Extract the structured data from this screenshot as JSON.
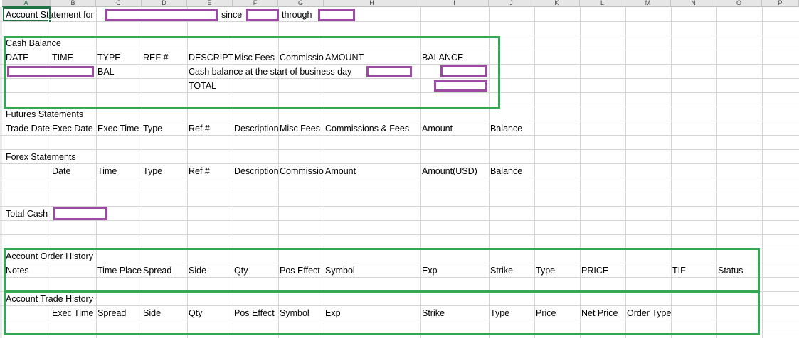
{
  "columns": [
    "A",
    "B",
    "C",
    "D",
    "E",
    "F",
    "G",
    "H",
    "I",
    "J",
    "K",
    "L",
    "M",
    "N",
    "O",
    "P"
  ],
  "header": {
    "account_statement_for": "Account Statement for",
    "since": "since",
    "through": "through"
  },
  "cash_balance": {
    "title": "Cash Balance",
    "headers": [
      "DATE",
      "TIME",
      "TYPE",
      "REF #",
      "DESCRIPTION",
      "Misc Fees",
      "Commissions",
      "AMOUNT",
      "BALANCE"
    ],
    "row_type": "BAL",
    "row_description": "Cash balance at the start of business day",
    "total_label": "TOTAL"
  },
  "futures": {
    "title": "Futures Statements",
    "headers": [
      "Trade Date",
      "Exec Date",
      "Exec Time",
      "Type",
      "Ref #",
      "Description",
      "Misc Fees",
      "Commissions & Fees",
      "Amount",
      "Balance"
    ]
  },
  "forex": {
    "title": "Forex Statements",
    "headers": [
      "Date",
      "Time",
      "Type",
      "Ref #",
      "Description",
      "Commissions",
      "Amount",
      "Amount(USD)",
      "Balance"
    ]
  },
  "total_cash": {
    "label": "Total Cash"
  },
  "order_history": {
    "title": "Account Order History",
    "headers": [
      "Notes",
      "Time Placed",
      "Spread",
      "Side",
      "Qty",
      "Pos Effect",
      "Symbol",
      "Exp",
      "Strike",
      "Type",
      "PRICE",
      "TIF",
      "Status"
    ]
  },
  "trade_history": {
    "title": "Account Trade History",
    "headers": [
      "Exec Time",
      "Spread",
      "Side",
      "Qty",
      "Pos Effect",
      "Symbol",
      "Exp",
      "Strike",
      "Type",
      "Price",
      "Net Price",
      "Order Type"
    ]
  },
  "colors": {
    "redaction": "#9c4aa4",
    "section_box": "#34a853",
    "selection": "#217346"
  }
}
